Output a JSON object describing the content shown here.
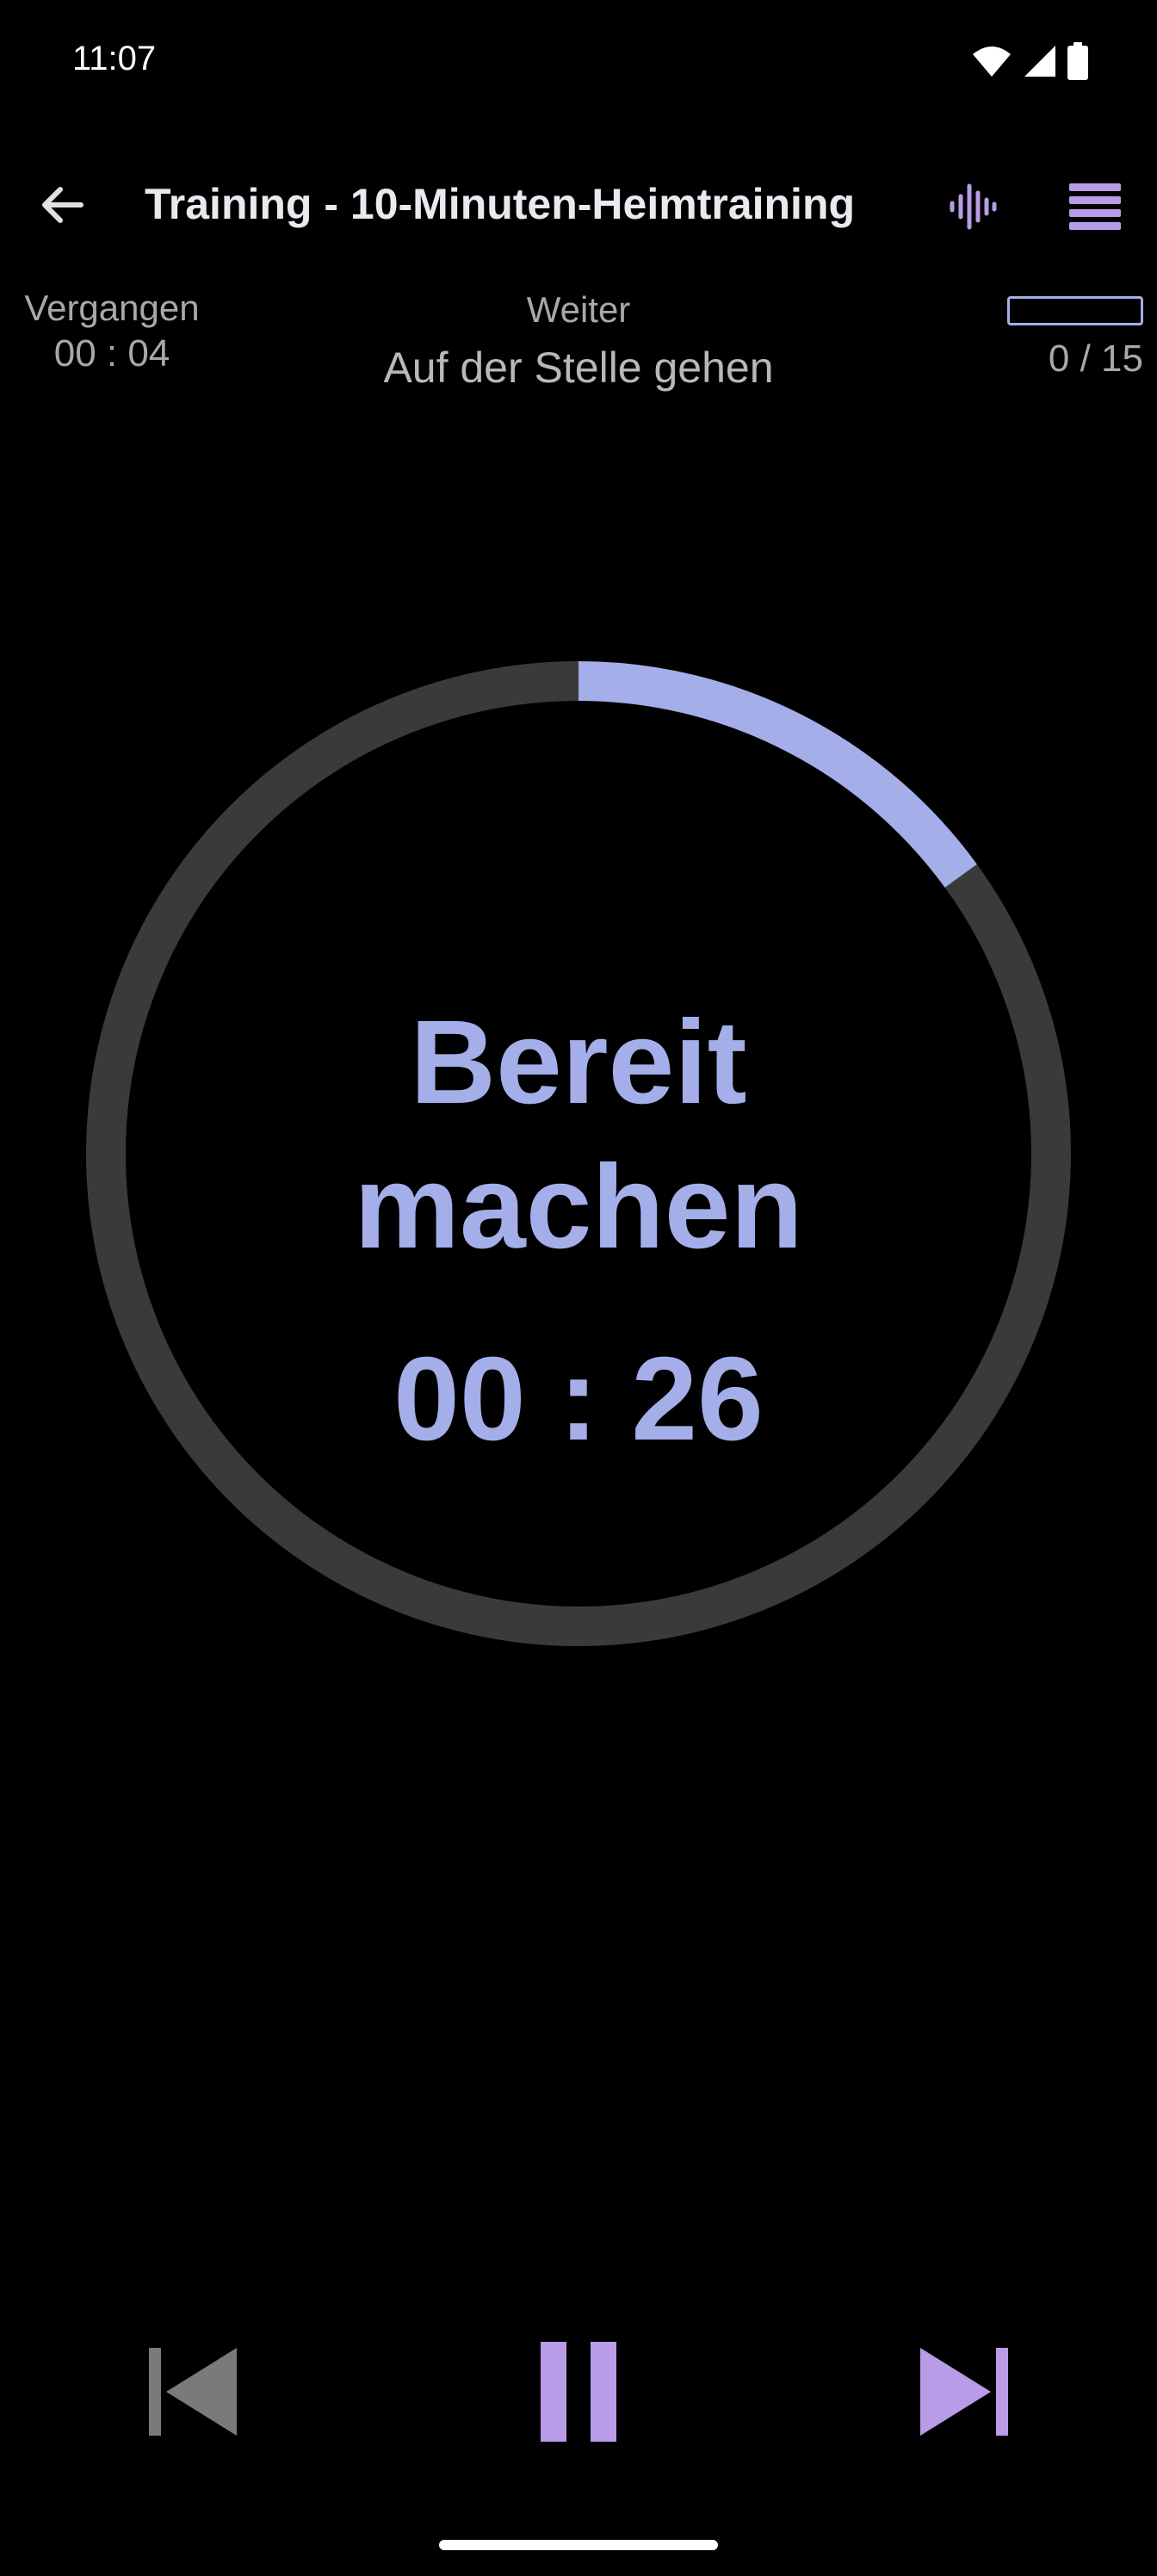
{
  "status_bar": {
    "time": "11:07",
    "icons": [
      "wifi-icon",
      "signal-icon",
      "battery-icon"
    ]
  },
  "app_bar": {
    "title": "Training - 10-Minuten-Heimtraining",
    "back_icon": "arrow-left-icon",
    "sound_icon": "audio-wave-icon",
    "menu_icon": "list-icon"
  },
  "info": {
    "elapsed_label": "Vergangen",
    "elapsed_value": "00 : 04",
    "next_label": "Weiter",
    "next_exercise": "Auf der Stelle gehen",
    "progress_count": "0 / 15",
    "progress_fraction": 0
  },
  "timer": {
    "phase_line1": "Bereit",
    "phase_line2": "machen",
    "countdown": "00 : 26",
    "ring_progress_fraction": 0.15
  },
  "controls": {
    "previous_icon": "skip-previous-icon",
    "pause_icon": "pause-icon",
    "next_icon": "skip-next-icon"
  },
  "colors": {
    "background": "#000000",
    "accent": "#a4aee8",
    "accent_purple": "#b99be8",
    "ring_track": "#3a3a3a",
    "muted_text": "#a8a8a8",
    "disabled_icon": "#7a7a7a"
  }
}
